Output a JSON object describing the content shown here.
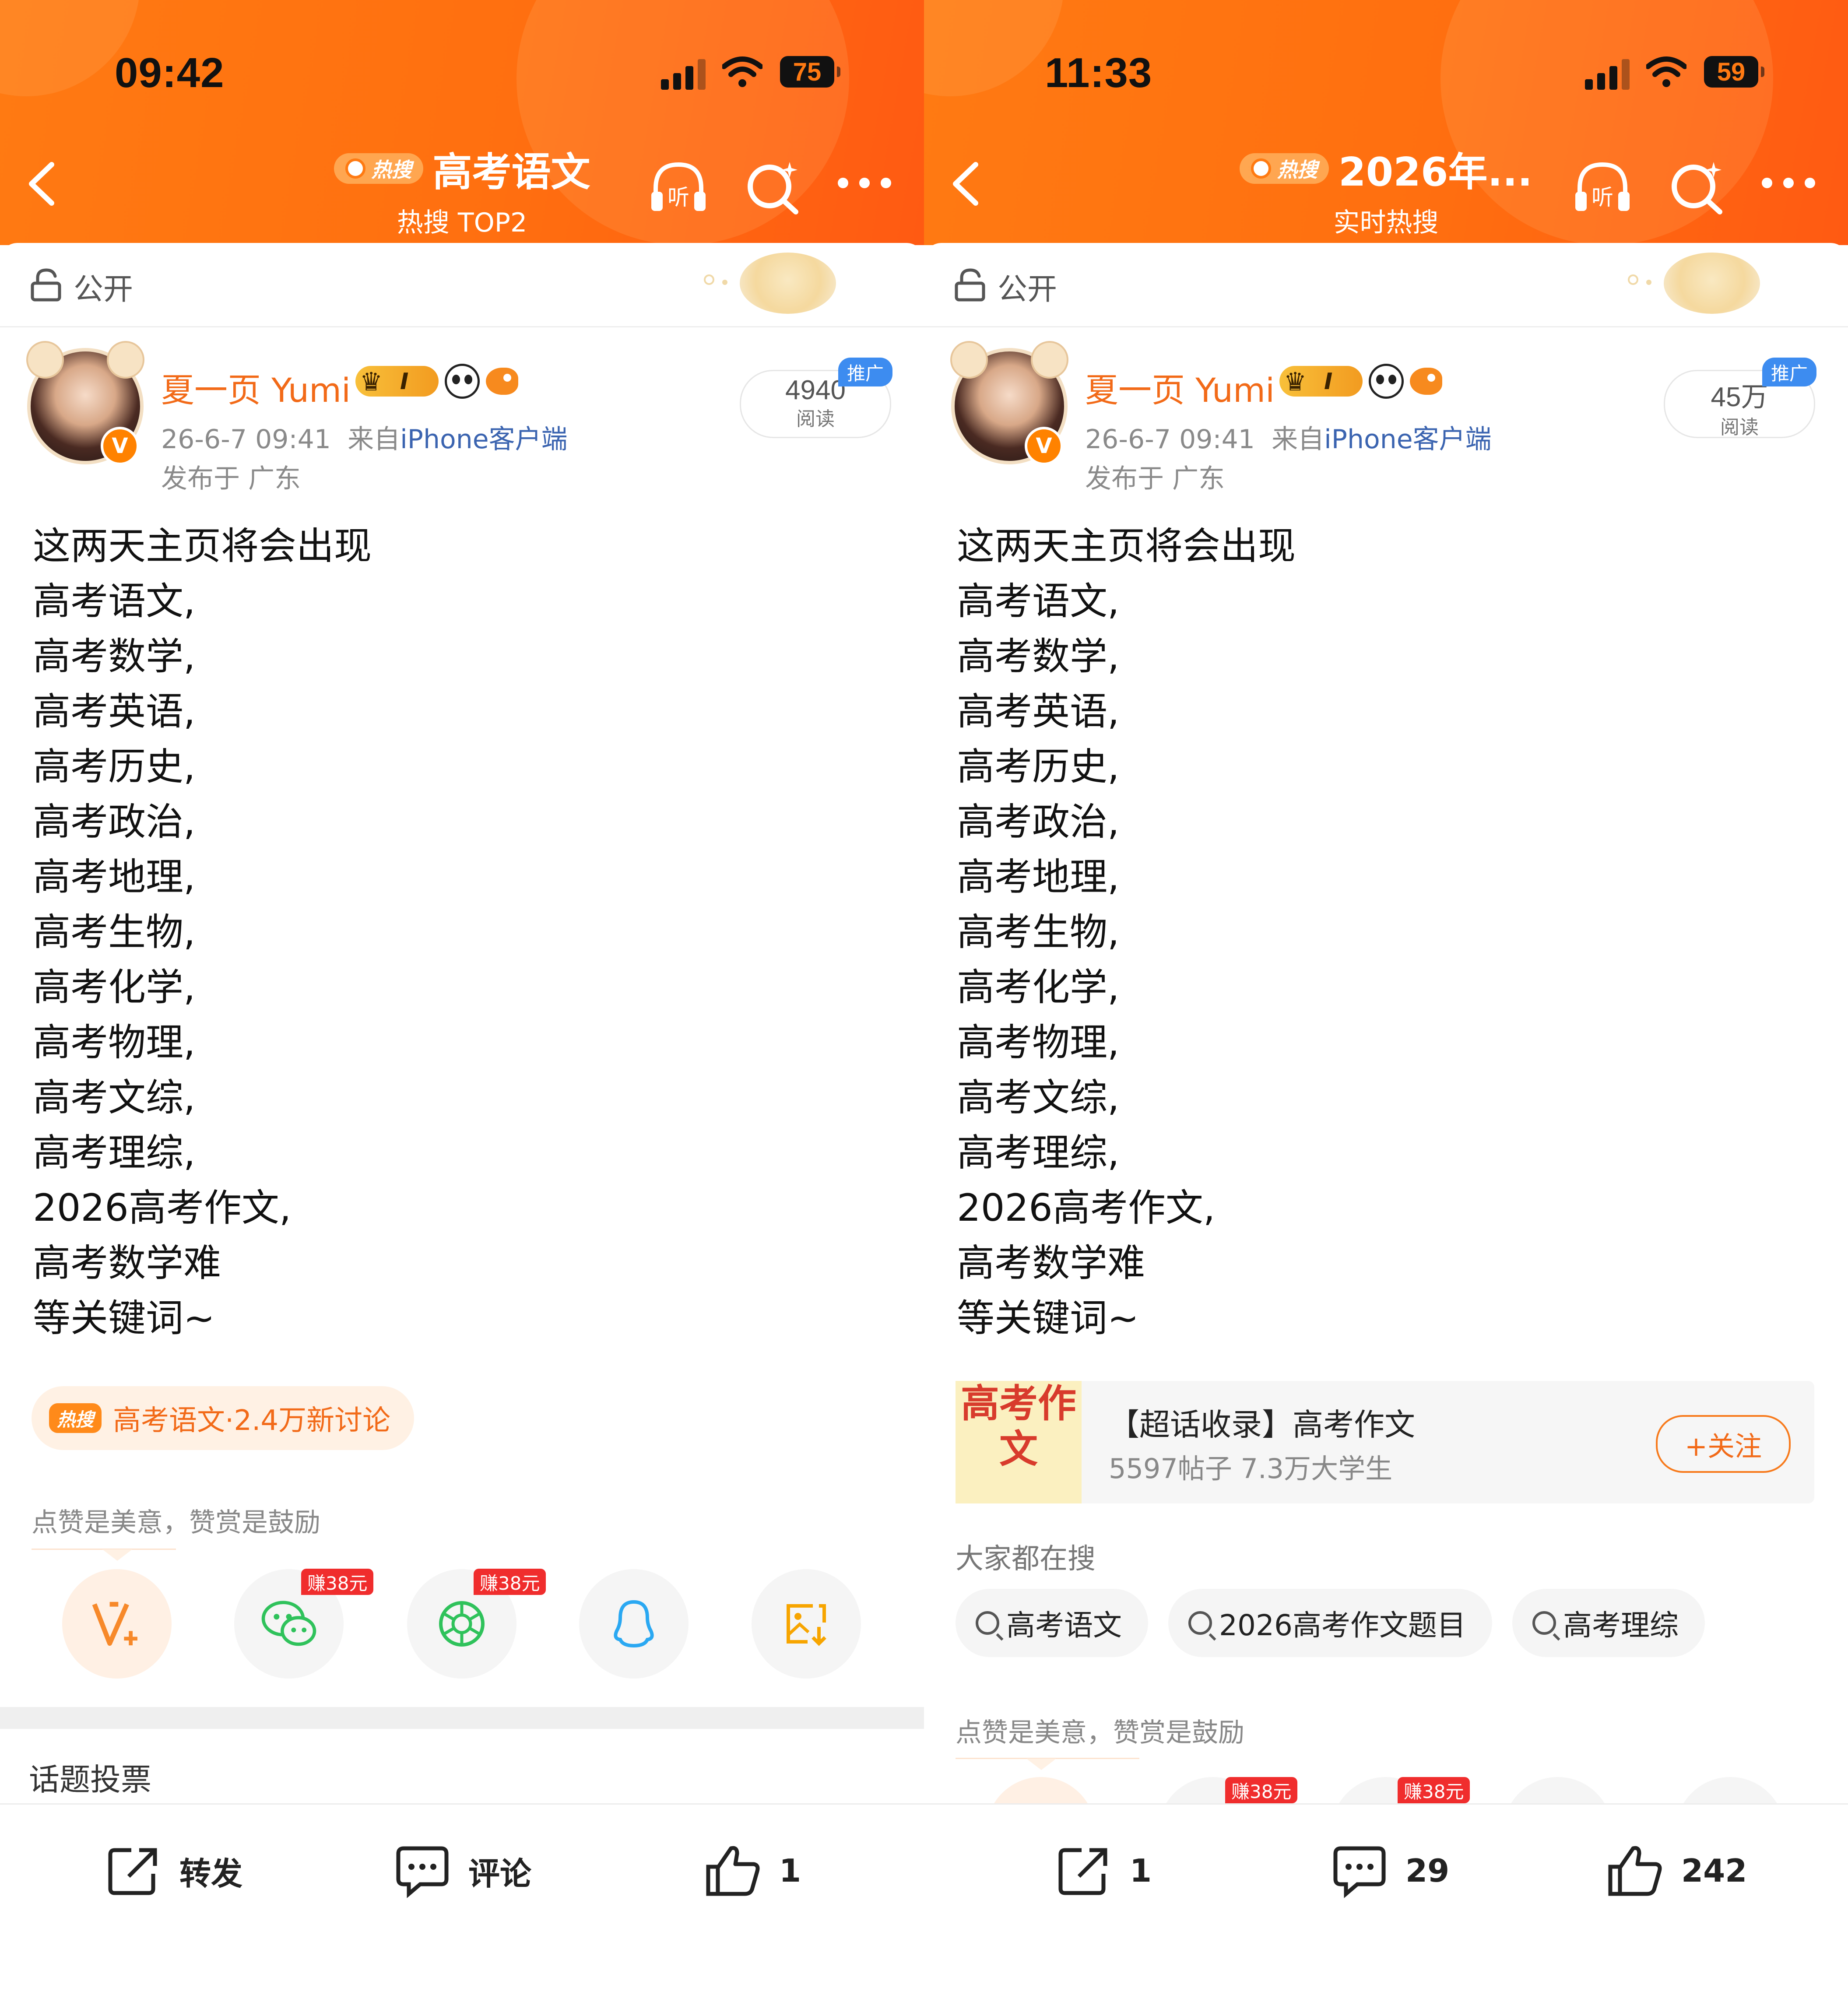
{
  "left": {
    "status": {
      "time": "09:42",
      "battery": "75"
    },
    "header": {
      "hot_tag": "热搜",
      "title": "高考语文",
      "subtitle": "热搜 TOP2"
    },
    "visibility": "公开",
    "author": {
      "name": "夏一页 Yumi",
      "level": "I",
      "verified": "V"
    },
    "meta": {
      "time": "26-6-7 09:41",
      "from": "来自",
      "source": "iPhone客户端",
      "location": "发布于 广东"
    },
    "reads": {
      "count": "4940",
      "label": "阅读",
      "promo": "推广"
    },
    "post_lines": [
      "这两天主页将会出现",
      "高考语文,",
      "高考数学,",
      "高考英语,",
      "高考历史,",
      "高考政治,",
      "高考地理,",
      "高考生物,",
      "高考化学,",
      "高考物理,",
      "高考文综,",
      "高考理综,",
      "2026高考作文,",
      "高考数学难",
      "等关键词~"
    ],
    "hot_topic": {
      "tag": "热搜",
      "text": "高考语文·2.4万新讨论"
    },
    "praise_text": "点赞是美意，赞赏是鼓励",
    "share": {
      "earn_1": "赚38元",
      "earn_2": "赚38元"
    },
    "topic_vote": "话题投票",
    "bottom": {
      "repost": "转发",
      "comment": "评论",
      "like": "1"
    }
  },
  "right": {
    "status": {
      "time": "11:33",
      "battery": "59"
    },
    "header": {
      "hot_tag": "热搜",
      "title": "2026年...",
      "subtitle": "实时热搜"
    },
    "visibility": "公开",
    "author": {
      "name": "夏一页 Yumi",
      "level": "I",
      "verified": "V"
    },
    "meta": {
      "time": "26-6-7 09:41",
      "from": "来自",
      "source": "iPhone客户端",
      "location": "发布于 广东"
    },
    "reads": {
      "count": "45万",
      "label": "阅读",
      "promo": "推广"
    },
    "post_lines": [
      "这两天主页将会出现",
      "高考语文,",
      "高考数学,",
      "高考英语,",
      "高考历史,",
      "高考政治,",
      "高考地理,",
      "高考生物,",
      "高考化学,",
      "高考物理,",
      "高考文综,",
      "高考理综,",
      "2026高考作文,",
      "高考数学难",
      "等关键词~"
    ],
    "chaohua": {
      "image_text": "高考作文",
      "title": "【超话收录】高考作文",
      "subtitle": "5597帖子 7.3万大学生",
      "follow": "+关注"
    },
    "everyone_searching": "大家都在搜",
    "chips": [
      "高考语文",
      "2026高考作文题目",
      "高考理综"
    ],
    "praise_text": "点赞是美意，赞赏是鼓励",
    "share": {
      "earn_1": "赚38元",
      "earn_2": "赚38元"
    },
    "bottom": {
      "repost": "1",
      "comment": "29",
      "like": "242"
    }
  },
  "colors": {
    "accent": "#ff7a12",
    "name": "#f26a18",
    "link": "#3b64b0",
    "promo": "#3d8cf0",
    "earn": "#f02d2d"
  }
}
